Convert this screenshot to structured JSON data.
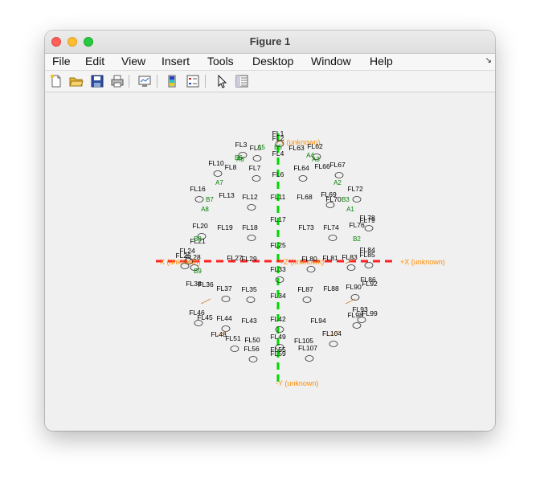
{
  "window": {
    "title": "Figure 1"
  },
  "menubar": {
    "items": [
      "File",
      "Edit",
      "View",
      "Insert",
      "Tools",
      "Desktop",
      "Window",
      "Help"
    ]
  },
  "toolbar": {
    "icons": [
      "new-figure-icon",
      "open-file-icon",
      "save-icon",
      "print-icon",
      "link-plot-icon",
      "colorbar-icon",
      "legend-icon",
      "edit-plot-icon",
      "property-inspector-icon"
    ]
  },
  "colors": {
    "x_axis": "#ff2020",
    "y_axis": "#00d800",
    "axis_label": "#ff8c00",
    "sensor_label": "#000000",
    "reference_label": "#008000"
  },
  "axes": {
    "pos_x_label": "+X (unknown)",
    "neg_x_label": "-X (unknown)",
    "pos_y_label": "+Y (unknown)",
    "neg_y_label": "-Y (unknown)",
    "z_label": "+Z (unknown)"
  },
  "sensor_labels": [
    "FL1",
    "FL2",
    "FL3",
    "FL4",
    "FL5",
    "FL6",
    "FL7",
    "FL8",
    "FL10",
    "FL11",
    "FL12",
    "FL13",
    "FL16",
    "FL17",
    "FL18",
    "FL19",
    "FL20",
    "FL21",
    "FL24",
    "FL25",
    "FL26",
    "FL27",
    "FL28",
    "FL29",
    "FL33",
    "FL34",
    "FL35",
    "FL36",
    "FL37",
    "FL38",
    "FL42",
    "FL43",
    "FL44",
    "FL45",
    "FL46",
    "FL48",
    "FL49",
    "FL50",
    "FL51",
    "FL55",
    "FL56",
    "FL59",
    "FL62",
    "FL63",
    "FL64",
    "FL66",
    "FL67",
    "FL68",
    "FL69",
    "FL70",
    "FL72",
    "FL73",
    "FL74",
    "FL76",
    "FL78",
    "FL79",
    "FL80",
    "FL81",
    "FL83",
    "FL84",
    "FL85",
    "FL86",
    "FL87",
    "FL88",
    "FL90",
    "FL92",
    "FL93",
    "FL94",
    "FL98",
    "FL99",
    "FL104",
    "FL105",
    "FL107"
  ],
  "reference_labels": [
    "A1",
    "A2",
    "A3",
    "A4",
    "A5",
    "A6",
    "A7",
    "A8",
    "B2",
    "B3",
    "B5",
    "B6",
    "B7",
    "B8",
    "B9"
  ]
}
